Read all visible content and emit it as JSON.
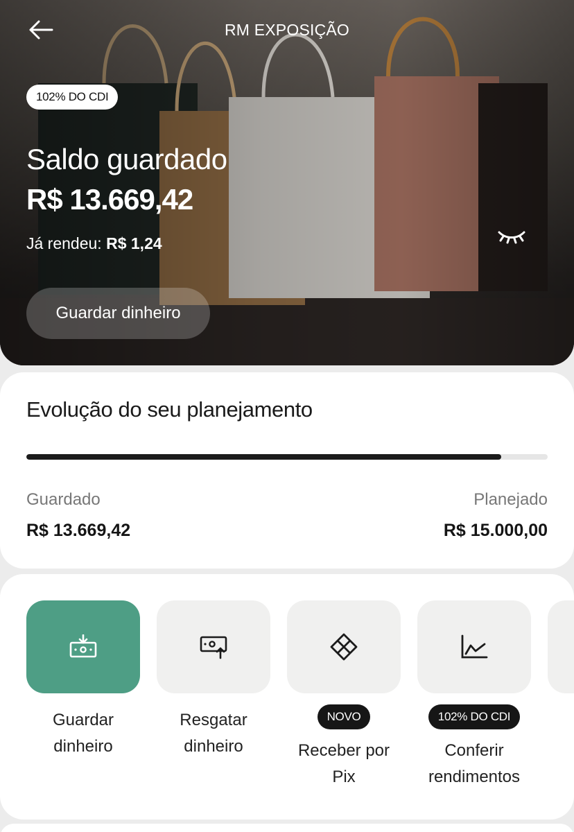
{
  "header": {
    "title": "RM EXPOSIÇÃO",
    "back_icon": "arrow-left-icon"
  },
  "hero": {
    "rate_badge": "102% DO CDI",
    "label": "Saldo guardado",
    "balance": "R$ 13.669,42",
    "earned_label": "Já rendeu:",
    "earned_value": "R$ 1,24",
    "visibility_icon": "eye-closed-icon",
    "cta_label": "Guardar dinheiro"
  },
  "planning": {
    "title": "Evolução do seu planejamento",
    "progress_fraction": 0.9113,
    "saved_label": "Guardado",
    "saved_value": "R$ 13.669,42",
    "planned_label": "Planejado",
    "planned_value": "R$ 15.000,00"
  },
  "actions": [
    {
      "label_line1": "Guardar",
      "label_line2": "dinheiro",
      "icon": "deposit-money-icon",
      "badge": ""
    },
    {
      "label_line1": "Resgatar",
      "label_line2": "dinheiro",
      "icon": "withdraw-money-icon",
      "badge": ""
    },
    {
      "label_line1": "Receber por",
      "label_line2": "Pix",
      "icon": "pix-icon",
      "badge": "NOVO"
    },
    {
      "label_line1": "Conferir",
      "label_line2": "rendimentos",
      "icon": "chart-line-icon",
      "badge": "102% DO CDI"
    }
  ],
  "colors": {
    "primary_action": "#4e9e85",
    "tile_background": "#f0f0ef",
    "badge_background": "#161616",
    "progress_fill": "#1b1b1b"
  }
}
